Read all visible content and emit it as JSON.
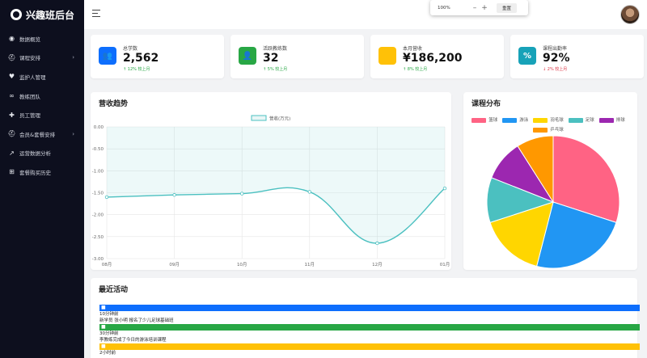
{
  "brand": {
    "title": "兴趣班后台",
    "logo_icon": "user-cog-icon"
  },
  "sidebar": {
    "items": [
      {
        "label": "数据概览",
        "icon": "dashboard-icon",
        "glyph": "◉",
        "has_submenu": false
      },
      {
        "label": "课程安排",
        "icon": "graduation-cap-icon",
        "glyph": "⛑",
        "has_submenu": true
      },
      {
        "label": "监护人管理",
        "icon": "heart-icon",
        "glyph": "♥",
        "has_submenu": false
      },
      {
        "label": "教练团队",
        "icon": "team-icon",
        "glyph": "∞",
        "has_submenu": false
      },
      {
        "label": "员工管理",
        "icon": "user-plus-icon",
        "glyph": "✚",
        "has_submenu": false
      },
      {
        "label": "会员&套餐安排",
        "icon": "graduation-cap-icon",
        "glyph": "⛑",
        "has_submenu": true
      },
      {
        "label": "运营数据分析",
        "icon": "line-chart-icon",
        "glyph": "↗",
        "has_submenu": false
      },
      {
        "label": "套餐购买历史",
        "icon": "cart-icon",
        "glyph": "⊞",
        "has_submenu": false
      }
    ]
  },
  "zoom": {
    "level": "100%",
    "minus": "–",
    "plus": "+",
    "reset_label": "重置"
  },
  "stats": [
    {
      "label": "总学数",
      "value": "2,562",
      "trend": "12% 较上月",
      "trend_dir": "up",
      "color": "#0d6efd",
      "icon": "users-icon",
      "glyph": "👥"
    },
    {
      "label": "活跃教练数",
      "value": "32",
      "trend": "5% 较上月",
      "trend_dir": "up",
      "color": "#28a745",
      "icon": "user-icon",
      "glyph": "👤"
    },
    {
      "label": "本月营收",
      "value": "¥186,200",
      "trend": "8% 较上月",
      "trend_dir": "up",
      "color": "#ffc107",
      "icon": "yen-icon",
      "glyph": ""
    },
    {
      "label": "课程出勤率",
      "value": "92%",
      "trend": "2% 较上月",
      "trend_dir": "down",
      "color": "#17a2b8",
      "icon": "percent-icon",
      "glyph": "%"
    }
  ],
  "revenue_panel": {
    "title": "营收趋势",
    "legend": "营收(万元)"
  },
  "course_panel": {
    "title": "课程分布"
  },
  "activity": {
    "title": "最近活动",
    "items": [
      {
        "time": "10分钟前",
        "text": "新学员 张小明 报名了少儿足球基础班",
        "color": "#0d6efd",
        "icon": "user-plus-icon"
      },
      {
        "time": "30分钟前",
        "text": "李教练完成了今日的游泳培训课程",
        "color": "#28a745",
        "icon": "check-icon"
      },
      {
        "time": "2小时前",
        "text": "",
        "color": "#ffc107",
        "icon": "yen-icon"
      }
    ]
  },
  "chart_data": [
    {
      "type": "line",
      "categories": [
        "08月",
        "09月",
        "10月",
        "11月",
        "12月",
        "01月"
      ],
      "series": [
        {
          "name": "营收(万元)",
          "values": [
            -1.6,
            -1.55,
            -1.52,
            -1.48,
            -2.65,
            -1.4
          ],
          "color": "#4bc0c0"
        }
      ],
      "ylim": [
        -3.0,
        0.0
      ],
      "yticks": [
        "0.00",
        "-0.50",
        "-1.00",
        "-1.50",
        "-2.00",
        "-2.50",
        "-3.00"
      ],
      "grid": true,
      "legend": "top-center"
    },
    {
      "type": "pie",
      "categories": [
        "篮球",
        "游泳",
        "羽毛球",
        "足球",
        "排球",
        "乒乓球"
      ],
      "values": [
        30,
        24,
        16,
        11,
        10,
        9
      ],
      "colors": [
        "#ff6384",
        "#2196f3",
        "#ffd600",
        "#4bc0c0",
        "#9c27b0",
        "#ff9800"
      ],
      "legend": "top"
    }
  ]
}
